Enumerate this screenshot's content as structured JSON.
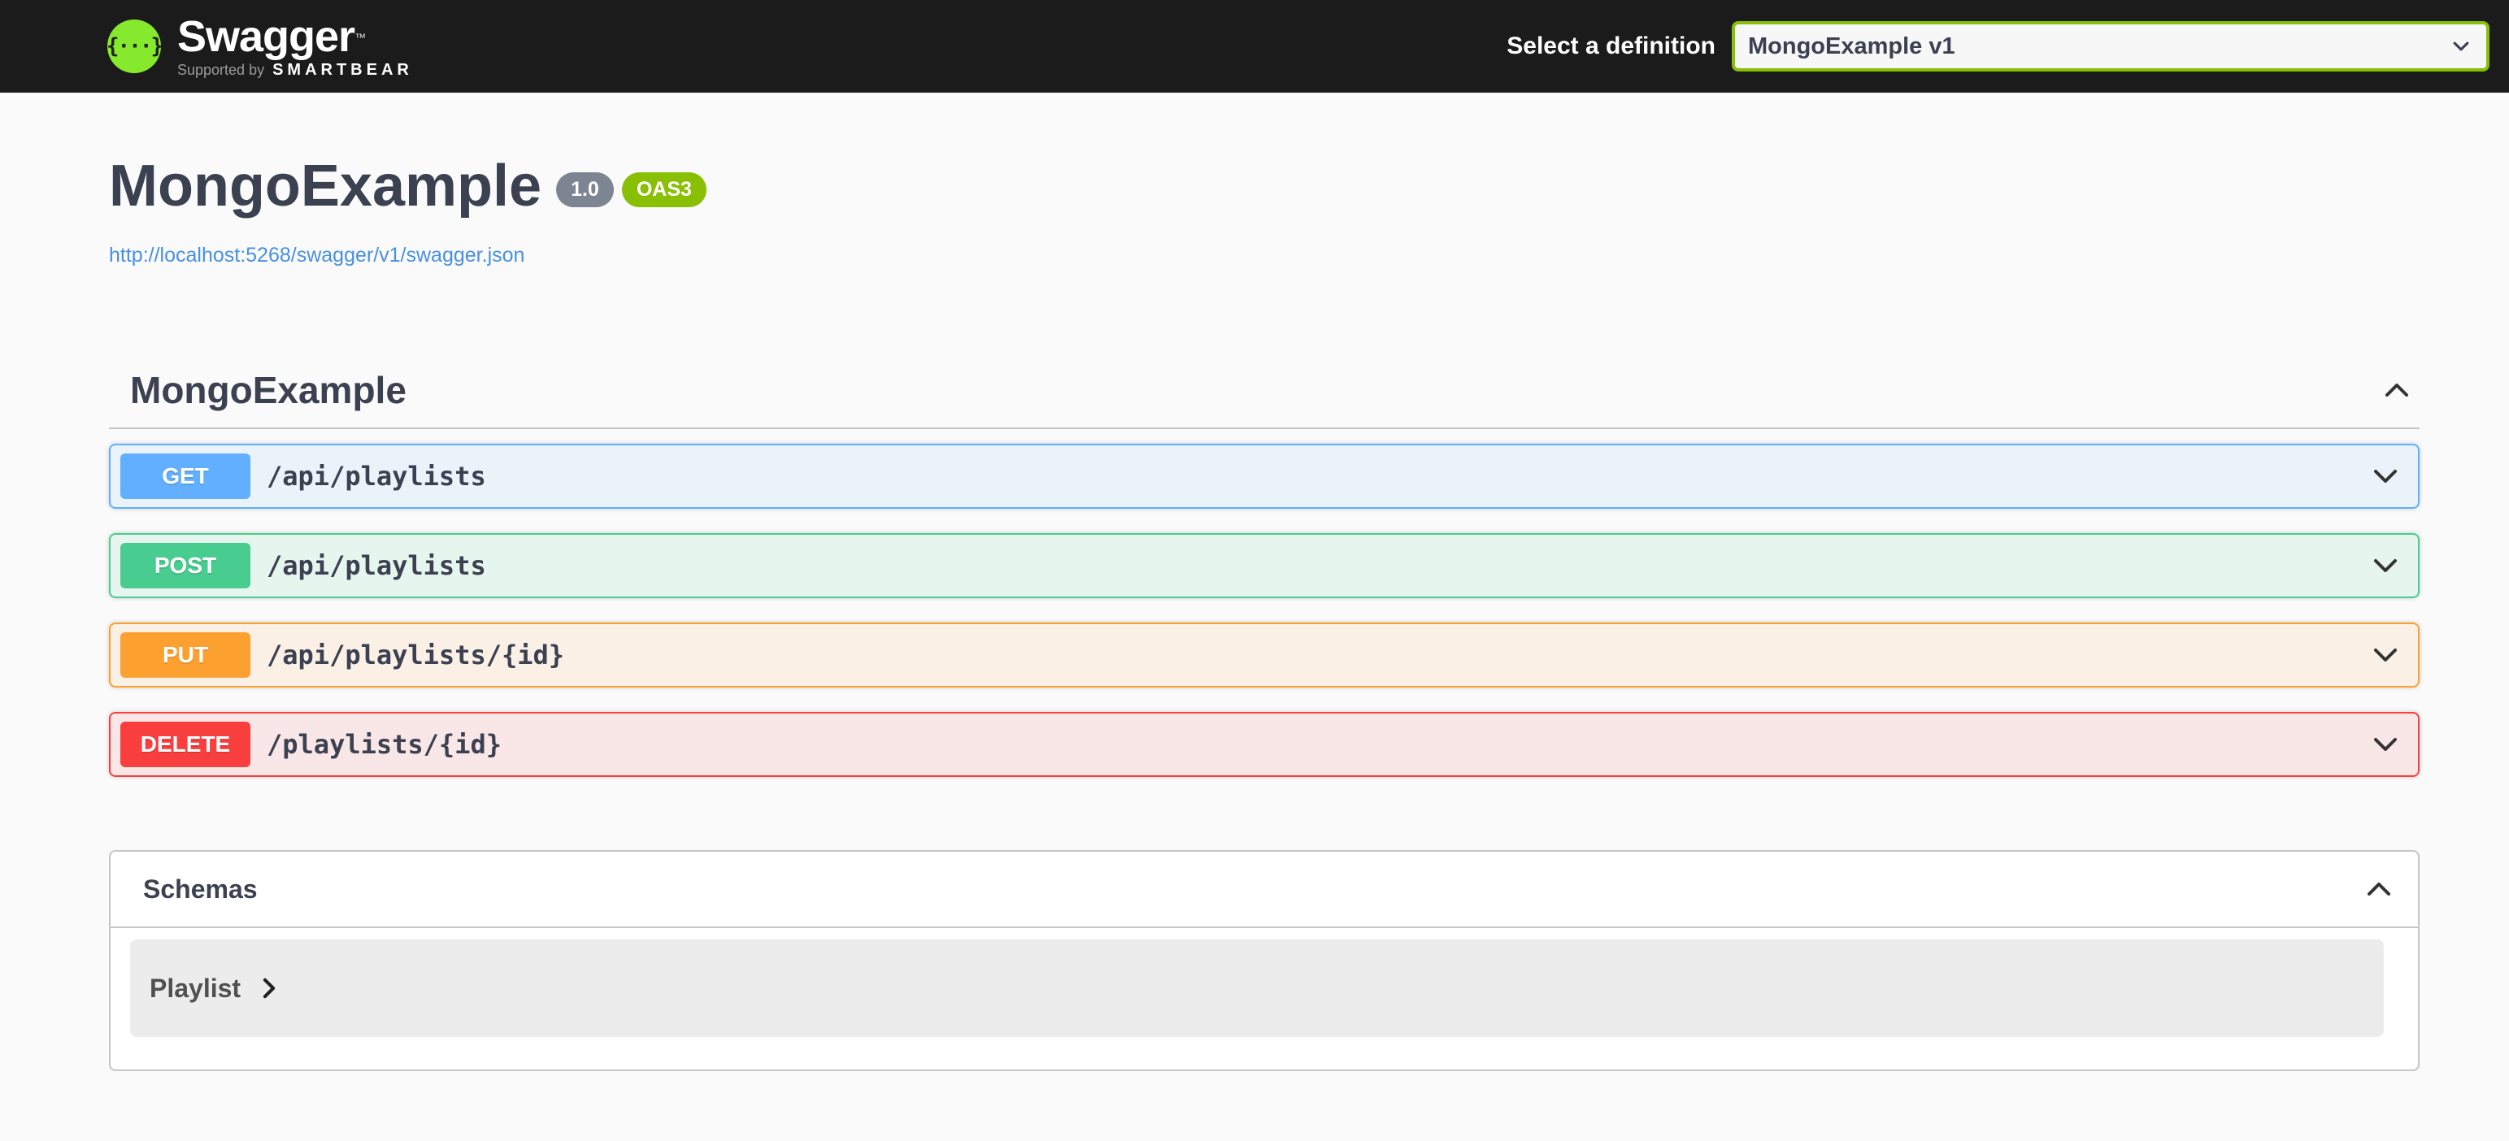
{
  "topbar": {
    "logo": {
      "braces": "{···}",
      "brand": "Swagger",
      "trademark": "™",
      "tagline_prefix": "Supported by",
      "tagline_brand": "SMARTBEAR"
    },
    "definition_label": "Select a definition",
    "definition_selected": "MongoExample v1"
  },
  "info": {
    "title": "MongoExample",
    "version_badge": "1.0",
    "oas_badge": "OAS3",
    "spec_link": "http://localhost:5268/swagger/v1/swagger.json"
  },
  "tag_section": {
    "title": "MongoExample"
  },
  "operations": [
    {
      "method": "GET",
      "path": "/api/playlists"
    },
    {
      "method": "POST",
      "path": "/api/playlists"
    },
    {
      "method": "PUT",
      "path": "/api/playlists/{id}"
    },
    {
      "method": "DELETE",
      "path": "/playlists/{id}"
    }
  ],
  "schemas": {
    "title": "Schemas",
    "models": [
      {
        "name": "Playlist"
      }
    ]
  },
  "colors": {
    "get": "#61affe",
    "post": "#49cc90",
    "put": "#fca130",
    "delete": "#f93e3e",
    "accent_green": "#89bf04",
    "logo_green": "#85ea2d",
    "topbar_bg": "#1b1b1b",
    "heading_text": "#3b4151",
    "link_blue": "#4990e2",
    "version_badge_bg": "#7d8492"
  }
}
